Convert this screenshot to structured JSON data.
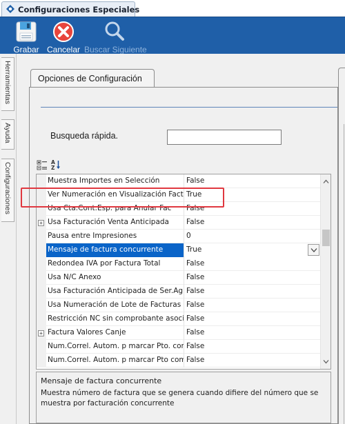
{
  "window": {
    "tab_title": "Configuraciones Especiales"
  },
  "toolbar": {
    "save_label": "Grabar",
    "cancel_label": "Cancelar",
    "find_next_label": "Buscar Siguiente"
  },
  "sidebar": {
    "tabs": [
      {
        "label": "Herramientas"
      },
      {
        "label": "Ayuda"
      },
      {
        "label": "Configuraciones"
      }
    ]
  },
  "panel": {
    "tab_label": "Opciones de Configuración",
    "search_label": "Busqueda rápida.",
    "search_value": ""
  },
  "grid": {
    "rows": [
      {
        "name": "Muestra Importes en Selección",
        "value": "False",
        "expandable": false,
        "selected": false
      },
      {
        "name": "Ver Numeración en Visualización Factura",
        "value": "True",
        "expandable": false,
        "selected": false
      },
      {
        "name": "Usa Cta.Cont.Esp. para Anular Fac",
        "value": "False",
        "expandable": false,
        "selected": false
      },
      {
        "name": "Usa Facturación Venta Anticipada",
        "value": "False",
        "expandable": true,
        "selected": false
      },
      {
        "name": "Pausa entre Impresiones",
        "value": "0",
        "expandable": false,
        "selected": false
      },
      {
        "name": "Mensaje de factura concurrente",
        "value": "True",
        "expandable": false,
        "selected": true
      },
      {
        "name": "Redondea IVA por Factura Total",
        "value": "False",
        "expandable": false,
        "selected": false
      },
      {
        "name": "Usa N/C Anexo",
        "value": "False",
        "expandable": false,
        "selected": false
      },
      {
        "name": "Usa Facturación Anticipada de Ser.Ag.",
        "value": "False",
        "expandable": false,
        "selected": false
      },
      {
        "name": "Usa Numeración de Lote de Facturas",
        "value": "False",
        "expandable": false,
        "selected": false
      },
      {
        "name": "Restricción NC sin comprobante asociado",
        "value": "False",
        "expandable": false,
        "selected": false
      },
      {
        "name": "Factura Valores Canje",
        "value": "False",
        "expandable": true,
        "selected": false
      },
      {
        "name": "Num.Correl. Autom. p marcar Pto. como",
        "value": "False",
        "expandable": false,
        "selected": false
      },
      {
        "name": "Num.Correl. Autom. p marcar Pto como",
        "value": "False",
        "expandable": false,
        "selected": false
      }
    ]
  },
  "description": {
    "title": "Mensaje de factura concurrente",
    "text": "Muestra número de factura que se genera cuando difiere del número que se muestra por facturación concurrente"
  },
  "colors": {
    "toolbar_bg": "#1f5fa8",
    "selection": "#0a64c8",
    "highlight_box": "#e0373f"
  },
  "icons": {
    "save": "floppy-disk-icon",
    "cancel": "cancel-x-icon",
    "find_next": "magnifier-icon",
    "categorized": "categorized-view-icon",
    "alphabetical": "sort-az-icon"
  }
}
